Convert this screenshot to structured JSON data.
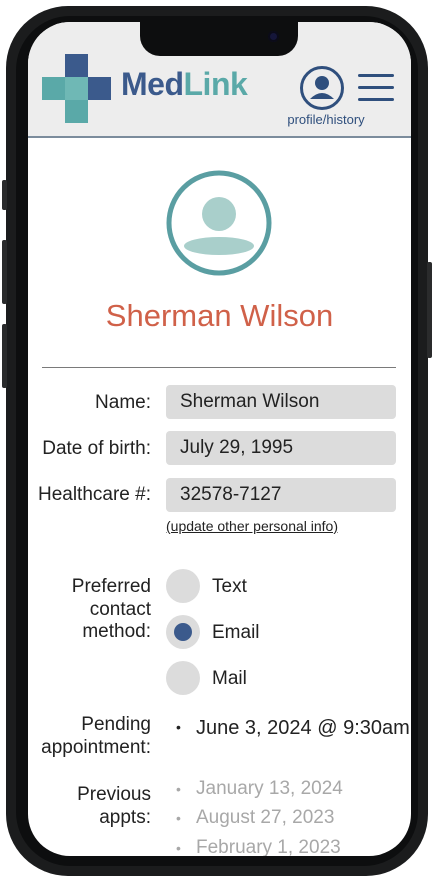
{
  "header": {
    "brand_part1": "Med",
    "brand_part2": "Link",
    "profile_label": "profile/history"
  },
  "patient": {
    "display_name": "Sherman Wilson"
  },
  "fields": {
    "name_label": "Name:",
    "name_value": "Sherman Wilson",
    "dob_label": "Date of birth:",
    "dob_value": "July 29, 1995",
    "healthcare_label": "Healthcare #:",
    "healthcare_value": "32578-7127",
    "update_link": "(update other personal info)"
  },
  "contact": {
    "label_line1": "Preferred",
    "label_line2": "contact",
    "label_line3": "method:",
    "options": [
      "Text",
      "Email",
      "Mail"
    ],
    "selected": "Email"
  },
  "appointments": {
    "pending_label_line1": "Pending",
    "pending_label_line2": "appointment:",
    "pending": "June 3, 2024 @ 9:30am",
    "previous_label_line1": "Previous",
    "previous_label_line2": "appts:",
    "previous": [
      "January 13, 2024",
      "August 27, 2023",
      "February 1, 2023"
    ]
  },
  "colors": {
    "brand_dark": "#3b5a8c",
    "brand_teal": "#5aa9a8",
    "name_accent": "#d06149",
    "field_bg": "#dcdcdc"
  },
  "icons": {
    "profile": "user-circle-icon",
    "menu": "hamburger-menu-icon",
    "logo": "medical-cross-logo"
  }
}
